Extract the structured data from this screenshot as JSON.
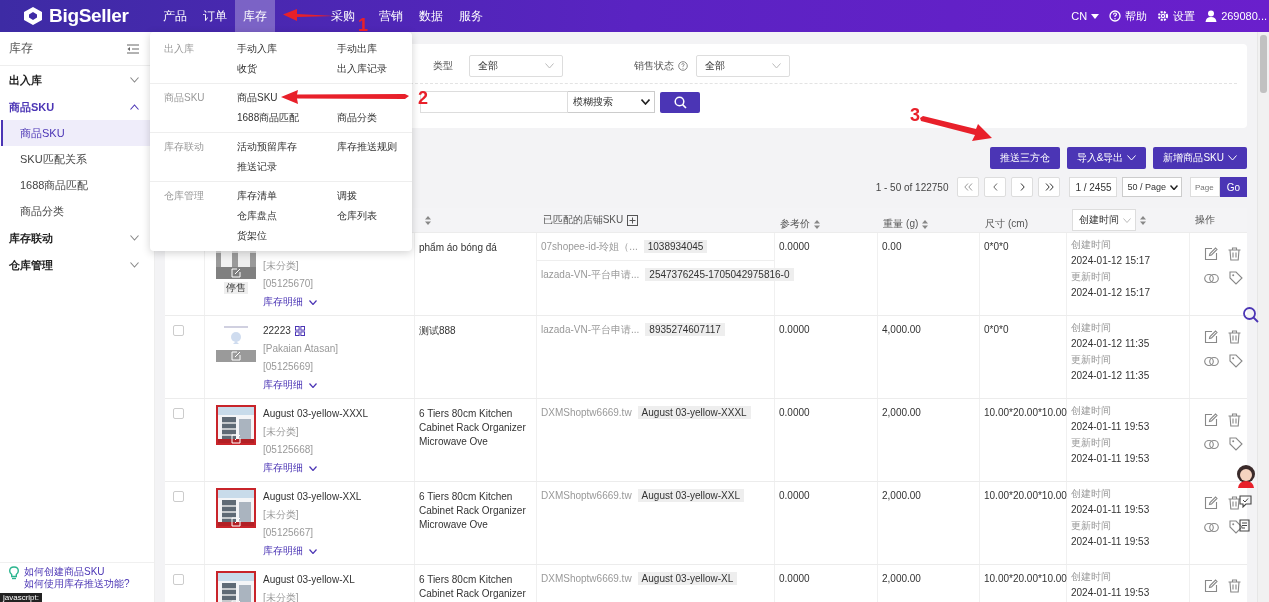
{
  "nav": {
    "logo": "BigSeller",
    "items": [
      {
        "label": "产品",
        "selected": false
      },
      {
        "label": "订单",
        "selected": false
      },
      {
        "label": "库存",
        "selected": true
      },
      {
        "label": "采购",
        "selected": false
      },
      {
        "label": "营销",
        "selected": false
      },
      {
        "label": "数据",
        "selected": false
      },
      {
        "label": "服务",
        "selected": false
      }
    ],
    "language": "CN",
    "help": "帮助",
    "settings": "设置",
    "user": "269080..."
  },
  "sidebar": {
    "title": "库存",
    "groups": [
      {
        "label": "出入库",
        "expanded": false
      },
      {
        "label": "商品SKU",
        "expanded": true,
        "children": [
          {
            "label": "商品SKU",
            "selected": true
          },
          {
            "label": "SKU匹配关系",
            "selected": false
          },
          {
            "label": "1688商品匹配",
            "selected": false
          },
          {
            "label": "商品分类",
            "selected": false
          }
        ]
      },
      {
        "label": "库存联动",
        "expanded": false
      },
      {
        "label": "仓库管理",
        "expanded": false
      }
    ],
    "help_links": [
      "如何创建商品SKU",
      "如何使用库存推送功能?"
    ]
  },
  "menu": {
    "sections": [
      {
        "label": "出入库",
        "rows": [
          [
            "手动入库",
            "手动出库"
          ],
          [
            "收货",
            "出入库记录"
          ]
        ]
      },
      {
        "label": "商品SKU",
        "rows": [
          [
            "商品SKU"
          ],
          [
            "1688商品匹配",
            "商品分类"
          ]
        ]
      },
      {
        "label": "库存联动",
        "rows": [
          [
            "活动预留库存",
            "库存推送规则"
          ],
          [
            "推送记录"
          ]
        ]
      },
      {
        "label": "仓库管理",
        "rows": [
          [
            "库存清单",
            "调拨"
          ],
          [
            "仓库盘点",
            "仓库列表"
          ],
          [
            "货架位"
          ]
        ]
      }
    ]
  },
  "filters": {
    "fields": [
      {
        "label": "类型",
        "value": "全部",
        "help": false
      },
      {
        "label": "销售状态",
        "value": "全部",
        "help": true
      }
    ],
    "search_mode": "模糊搜索"
  },
  "toolbar": {
    "buttons": [
      {
        "label": "推送三方仓",
        "dropdown": false
      },
      {
        "label": "导入&导出",
        "dropdown": true
      },
      {
        "label": "新增商品SKU",
        "dropdown": true
      }
    ]
  },
  "pagination": {
    "range": "1 - 50 of 122750",
    "page": "1 / 2455",
    "page_size": "50 / Page",
    "page_placeholder": "Page",
    "go": "Go"
  },
  "table": {
    "columns": [
      {
        "sortable": true
      },
      {
        "label": "已匹配的店铺SKU",
        "sortable": false,
        "kind": "add"
      },
      {
        "label": "参考价",
        "sortable": true
      },
      {
        "label": "重量 (g)",
        "sortable": true
      },
      {
        "label": "尺寸 (cm)",
        "sortable": false
      },
      {
        "label": "创建时间",
        "sortable": true,
        "kind": "select"
      },
      {
        "label": "操作",
        "sortable": false
      }
    ],
    "rows": [
      {
        "kind": "picture",
        "status": "停售",
        "category": "[未分类]",
        "code": "[05125670]",
        "detail": "库存明细",
        "name": "phẩm áo bóng đá",
        "matched": [
          {
            "shop": "07shopee-id-玲姐（...",
            "sku": "1038934045"
          },
          {
            "shop": "lazada-VN-平台申请...",
            "sku": "2547376245-1705042975816-0"
          }
        ],
        "price": "0.0000",
        "weight": "0.00",
        "size": "0*0*0",
        "created_label": "创建时间",
        "created": "2024-01-12 15:17",
        "updated_label": "更新时间",
        "updated": "2024-01-12 15:17"
      },
      {
        "checked": false,
        "kind": "picture",
        "sku": "22223",
        "category": "[Pakaian Atasan]",
        "code": "[05125669]",
        "detail": "库存明细",
        "name": "测试888",
        "matched": [
          {
            "shop": "lazada-VN-平台申请...",
            "sku": "8935274607117"
          }
        ],
        "price": "0.0000",
        "weight": "4,000.00",
        "size": "0*0*0",
        "created_label": "创建时间",
        "created": "2024-01-12 11:35",
        "updated_label": "更新时间",
        "updated": "2024-01-12 11:35"
      },
      {
        "checked": false,
        "kind": "picture",
        "sku": "August 03-yellow-XXXL",
        "category": "[未分类]",
        "code": "[05125668]",
        "detail": "库存明细",
        "name": "6 Tiers 80cm Kitchen Cabinet Rack Organizer Microwave Ove",
        "matched": [
          {
            "shop": "DXMShoptw6669.tw",
            "sku": "August 03-yellow-XXXL"
          }
        ],
        "price": "0.0000",
        "weight": "2,000.00",
        "size": "10.00*20.00*10.00",
        "created_label": "创建时间",
        "created": "2024-01-11 19:53",
        "updated_label": "更新时间",
        "updated": "2024-01-11 19:53"
      },
      {
        "checked": false,
        "kind": "picture",
        "sku": "August 03-yellow-XXL",
        "category": "[未分类]",
        "code": "[05125667]",
        "detail": "库存明细",
        "name": "6 Tiers 80cm Kitchen Cabinet Rack Organizer Microwave Ove",
        "matched": [
          {
            "shop": "DXMShoptw6669.tw",
            "sku": "August 03-yellow-XXL"
          }
        ],
        "price": "0.0000",
        "weight": "2,000.00",
        "size": "10.00*20.00*10.00",
        "created_label": "创建时间",
        "created": "2024-01-11 19:53",
        "updated_label": "更新时间",
        "updated": "2024-01-11 19:53"
      },
      {
        "checked": false,
        "kind": "picture",
        "sku": "August 03-yellow-XL",
        "category": "[未分类]",
        "name": "6 Tiers 80cm Kitchen Cabinet Rack Organizer",
        "matched": [
          {
            "shop": "DXMShoptw6669.tw",
            "sku": "August 03-yellow-XL"
          }
        ],
        "price": "0.0000",
        "weight": "2,000.00",
        "size": "10.00*20.00*10.00",
        "created_label": "创建时间",
        "created": "2024-01-11 19:53"
      }
    ]
  },
  "annotations": [
    {
      "label": "1"
    },
    {
      "label": "2"
    },
    {
      "label": "3"
    }
  ],
  "status_bar": "javascript:"
}
